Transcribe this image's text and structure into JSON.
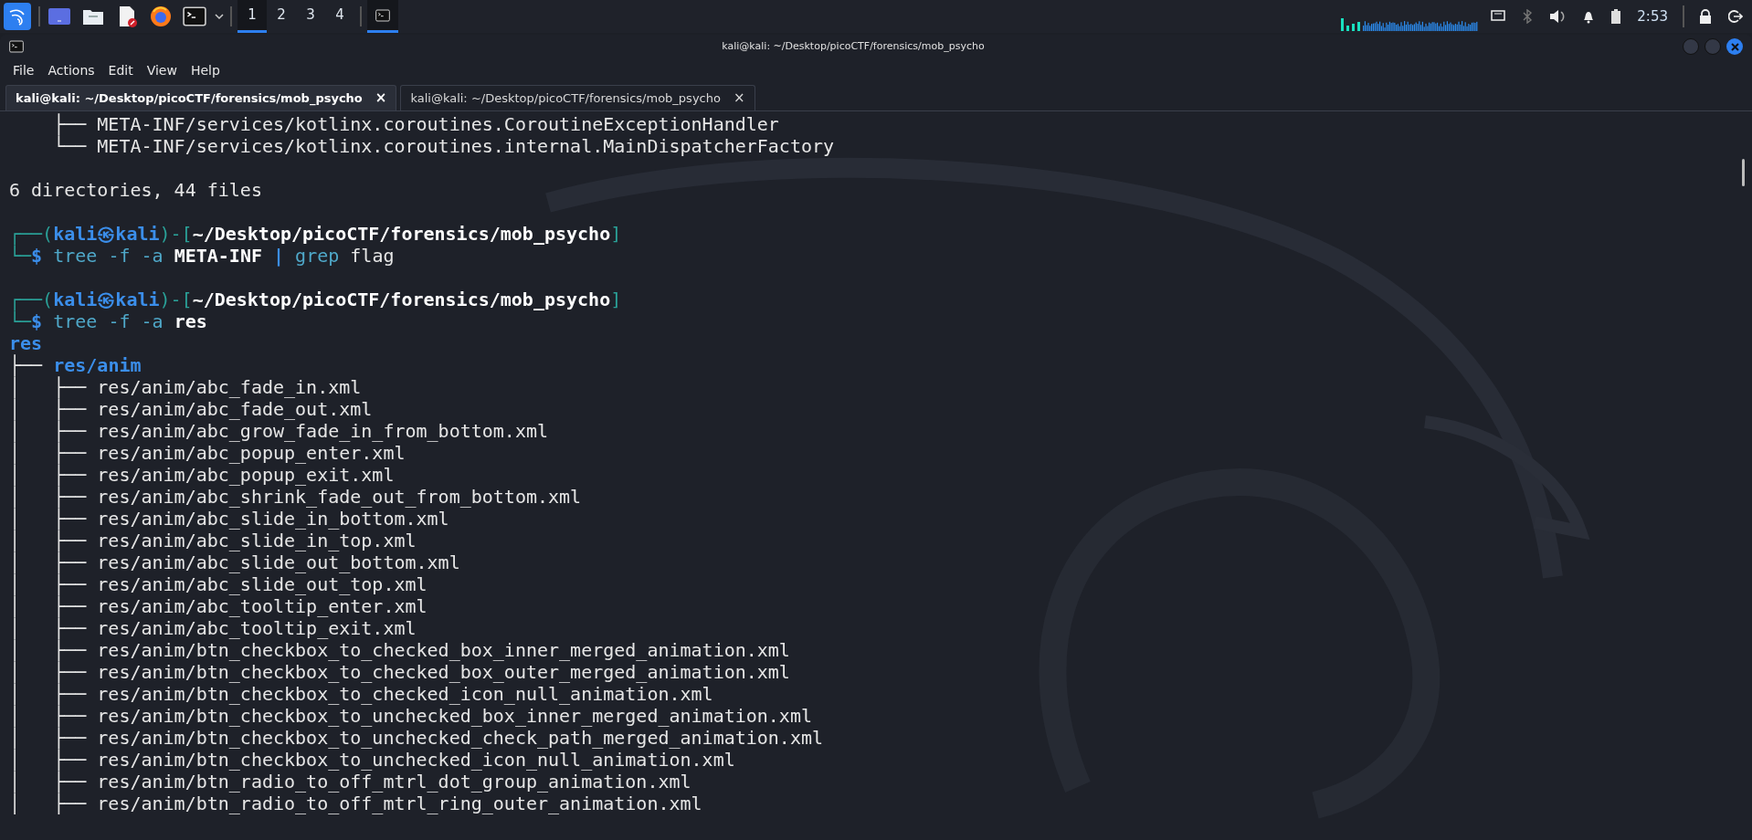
{
  "taskbar": {
    "launchers": [
      {
        "kind": "desktop"
      },
      {
        "kind": "files"
      },
      {
        "kind": "editor"
      },
      {
        "kind": "browser"
      },
      {
        "kind": "terminal"
      }
    ],
    "workspaces": [
      {
        "label": "1",
        "selected": true
      },
      {
        "label": "2",
        "selected": false
      },
      {
        "label": "3",
        "selected": false
      },
      {
        "label": "4",
        "selected": false
      }
    ],
    "tasks": [
      {
        "kind": "terminal",
        "selected": true
      }
    ],
    "clock": "2:53"
  },
  "window": {
    "title": "kali@kali: ~/Desktop/picoCTF/forensics/mob_psycho",
    "menu": [
      "File",
      "Actions",
      "Edit",
      "View",
      "Help"
    ],
    "tabs": [
      {
        "label": "kali@kali: ~/Desktop/picoCTF/forensics/mob_psycho",
        "close": "×",
        "selected": true
      },
      {
        "label": "kali@kali: ~/Desktop/picoCTF/forensics/mob_psycho",
        "close": "×",
        "selected": false
      }
    ]
  },
  "terminal": {
    "lines": [
      {
        "kind": "text",
        "segments": [
          {
            "text": "    ├── META-INF/services/kotlinx.coroutines.CoroutineExceptionHandler",
            "kind": "plain"
          }
        ]
      },
      {
        "kind": "text",
        "segments": [
          {
            "text": "    └── META-INF/services/kotlinx.coroutines.internal.MainDispatcherFactory",
            "kind": "plain"
          }
        ]
      },
      {
        "kind": "blank"
      },
      {
        "kind": "text",
        "segments": [
          {
            "text": "6 directories, 44 files",
            "kind": "plain"
          }
        ]
      },
      {
        "kind": "blank"
      },
      {
        "kind": "text",
        "segments": [
          {
            "text": "┌──(",
            "kind": "frame"
          },
          {
            "text": "kali㉿kali",
            "kind": "user"
          },
          {
            "text": ")-[",
            "kind": "frame"
          },
          {
            "text": "~/Desktop/picoCTF/forensics/mob_psycho",
            "kind": "bold"
          },
          {
            "text": "]",
            "kind": "frame"
          }
        ]
      },
      {
        "kind": "text",
        "segments": [
          {
            "text": "└─",
            "kind": "frame"
          },
          {
            "text": "$ ",
            "kind": "user"
          },
          {
            "text": "tree -f -a ",
            "kind": "cmd"
          },
          {
            "text": "META-INF ",
            "kind": "bold"
          },
          {
            "text": "| ",
            "kind": "user"
          },
          {
            "text": "grep ",
            "kind": "cmd"
          },
          {
            "text": "flag",
            "kind": "plain"
          }
        ]
      },
      {
        "kind": "blank"
      },
      {
        "kind": "text",
        "segments": [
          {
            "text": "┌──(",
            "kind": "frame"
          },
          {
            "text": "kali㉿kali",
            "kind": "user"
          },
          {
            "text": ")-[",
            "kind": "frame"
          },
          {
            "text": "~/Desktop/picoCTF/forensics/mob_psycho",
            "kind": "bold"
          },
          {
            "text": "]",
            "kind": "frame"
          }
        ]
      },
      {
        "kind": "text",
        "segments": [
          {
            "text": "└─",
            "kind": "frame"
          },
          {
            "text": "$ ",
            "kind": "user"
          },
          {
            "text": "tree -f -a ",
            "kind": "cmd"
          },
          {
            "text": "res",
            "kind": "bold"
          }
        ]
      },
      {
        "kind": "text",
        "segments": [
          {
            "text": "res",
            "kind": "dir"
          }
        ]
      },
      {
        "kind": "text",
        "segments": [
          {
            "text": "├── ",
            "kind": "plain"
          },
          {
            "text": "res/anim",
            "kind": "dir"
          }
        ]
      },
      {
        "kind": "text",
        "segments": [
          {
            "text": "│   ├── res/anim/abc_fade_in.xml",
            "kind": "plain"
          }
        ]
      },
      {
        "kind": "text",
        "segments": [
          {
            "text": "│   ├── res/anim/abc_fade_out.xml",
            "kind": "plain"
          }
        ]
      },
      {
        "kind": "text",
        "segments": [
          {
            "text": "│   ├── res/anim/abc_grow_fade_in_from_bottom.xml",
            "kind": "plain"
          }
        ]
      },
      {
        "kind": "text",
        "segments": [
          {
            "text": "│   ├── res/anim/abc_popup_enter.xml",
            "kind": "plain"
          }
        ]
      },
      {
        "kind": "text",
        "segments": [
          {
            "text": "│   ├── res/anim/abc_popup_exit.xml",
            "kind": "plain"
          }
        ]
      },
      {
        "kind": "text",
        "segments": [
          {
            "text": "│   ├── res/anim/abc_shrink_fade_out_from_bottom.xml",
            "kind": "plain"
          }
        ]
      },
      {
        "kind": "text",
        "segments": [
          {
            "text": "│   ├── res/anim/abc_slide_in_bottom.xml",
            "kind": "plain"
          }
        ]
      },
      {
        "kind": "text",
        "segments": [
          {
            "text": "│   ├── res/anim/abc_slide_in_top.xml",
            "kind": "plain"
          }
        ]
      },
      {
        "kind": "text",
        "segments": [
          {
            "text": "│   ├── res/anim/abc_slide_out_bottom.xml",
            "kind": "plain"
          }
        ]
      },
      {
        "kind": "text",
        "segments": [
          {
            "text": "│   ├── res/anim/abc_slide_out_top.xml",
            "kind": "plain"
          }
        ]
      },
      {
        "kind": "text",
        "segments": [
          {
            "text": "│   ├── res/anim/abc_tooltip_enter.xml",
            "kind": "plain"
          }
        ]
      },
      {
        "kind": "text",
        "segments": [
          {
            "text": "│   ├── res/anim/abc_tooltip_exit.xml",
            "kind": "plain"
          }
        ]
      },
      {
        "kind": "text",
        "segments": [
          {
            "text": "│   ├── res/anim/btn_checkbox_to_checked_box_inner_merged_animation.xml",
            "kind": "plain"
          }
        ]
      },
      {
        "kind": "text",
        "segments": [
          {
            "text": "│   ├── res/anim/btn_checkbox_to_checked_box_outer_merged_animation.xml",
            "kind": "plain"
          }
        ]
      },
      {
        "kind": "text",
        "segments": [
          {
            "text": "│   ├── res/anim/btn_checkbox_to_checked_icon_null_animation.xml",
            "kind": "plain"
          }
        ]
      },
      {
        "kind": "text",
        "segments": [
          {
            "text": "│   ├── res/anim/btn_checkbox_to_unchecked_box_inner_merged_animation.xml",
            "kind": "plain"
          }
        ]
      },
      {
        "kind": "text",
        "segments": [
          {
            "text": "│   ├── res/anim/btn_checkbox_to_unchecked_check_path_merged_animation.xml",
            "kind": "plain"
          }
        ]
      },
      {
        "kind": "text",
        "segments": [
          {
            "text": "│   ├── res/anim/btn_checkbox_to_unchecked_icon_null_animation.xml",
            "kind": "plain"
          }
        ]
      },
      {
        "kind": "text",
        "segments": [
          {
            "text": "│   ├── res/anim/btn_radio_to_off_mtrl_dot_group_animation.xml",
            "kind": "plain"
          }
        ]
      },
      {
        "kind": "text",
        "segments": [
          {
            "text": "│   ├── res/anim/btn_radio_to_off_mtrl_ring_outer_animation.xml",
            "kind": "plain"
          }
        ]
      }
    ]
  }
}
